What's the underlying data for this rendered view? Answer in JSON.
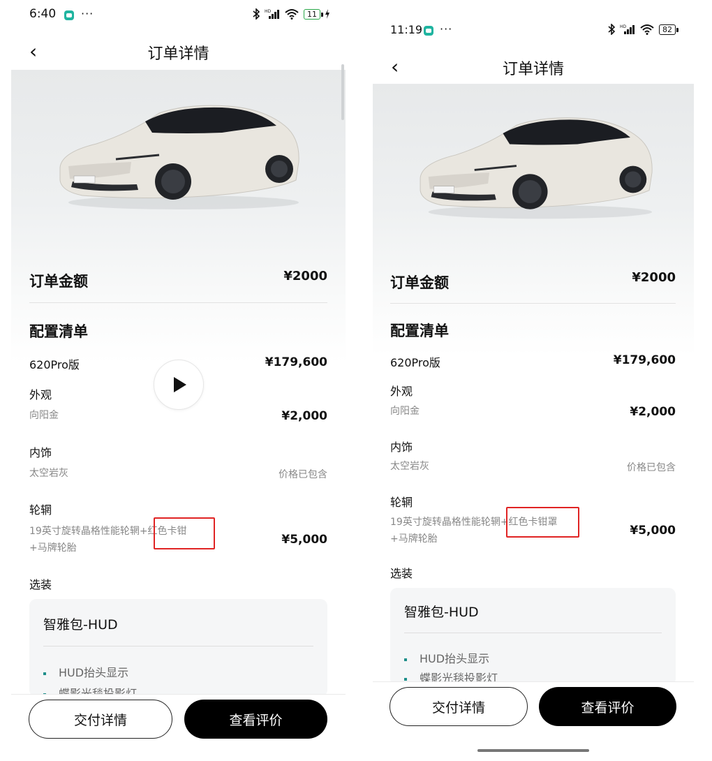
{
  "left": {
    "status": {
      "time": "6:40",
      "dots": "···",
      "battery": "11"
    },
    "nav": {
      "title": "订单详情",
      "back": "‹"
    },
    "order_amount": {
      "label": "订单金额",
      "value": "¥2000"
    },
    "config": {
      "title": "配置清单",
      "version": {
        "label": "620Pro版",
        "price": "¥179,600"
      },
      "exterior": {
        "label": "外观",
        "value": "向阳金",
        "price": "¥2,000"
      },
      "interior": {
        "label": "内饰",
        "value": "太空岩灰",
        "price": "价格已包含"
      },
      "wheels": {
        "label": "轮辋",
        "value_line1": "19英寸旋转晶格性能轮辋+红色卡钳",
        "value_line2": "+马牌轮胎",
        "price": "¥5,000"
      },
      "options_label": "选装"
    },
    "option_card": {
      "title": "智雅包-HUD",
      "features": [
        "HUD抬头显示",
        "蝶影光毯投影灯"
      ]
    },
    "buttons": {
      "delivery": "交付详情",
      "review": "查看评价"
    }
  },
  "right": {
    "status": {
      "time": "11:19",
      "dots": "···",
      "battery": "82"
    },
    "nav": {
      "title": "订单详情",
      "back": "‹"
    },
    "order_amount": {
      "label": "订单金额",
      "value": "¥2000"
    },
    "config": {
      "title": "配置清单",
      "version": {
        "label": "620Pro版",
        "price": "¥179,600"
      },
      "exterior": {
        "label": "外观",
        "value": "向阳金",
        "price": "¥2,000"
      },
      "interior": {
        "label": "内饰",
        "value": "太空岩灰",
        "price": "价格已包含"
      },
      "wheels": {
        "label": "轮辋",
        "value_line1": "19英寸旋转晶格性能轮辋+红色卡钳罩",
        "value_line2": "+马牌轮胎",
        "price": "¥5,000"
      },
      "options_label": "选装"
    },
    "option_card": {
      "title": "智雅包-HUD",
      "features": [
        "HUD抬头显示",
        "蝶影光毯投影灯"
      ]
    },
    "buttons": {
      "delivery": "交付详情",
      "review": "查看评价"
    }
  },
  "colors": {
    "highlight": "#e02424",
    "accent_dot": "#1f8f8a",
    "button_dark": "#000000"
  },
  "icons": [
    "back-icon",
    "play-icon",
    "bluetooth-icon",
    "signal-icon",
    "wifi-icon",
    "battery-icon",
    "charging-icon"
  ]
}
